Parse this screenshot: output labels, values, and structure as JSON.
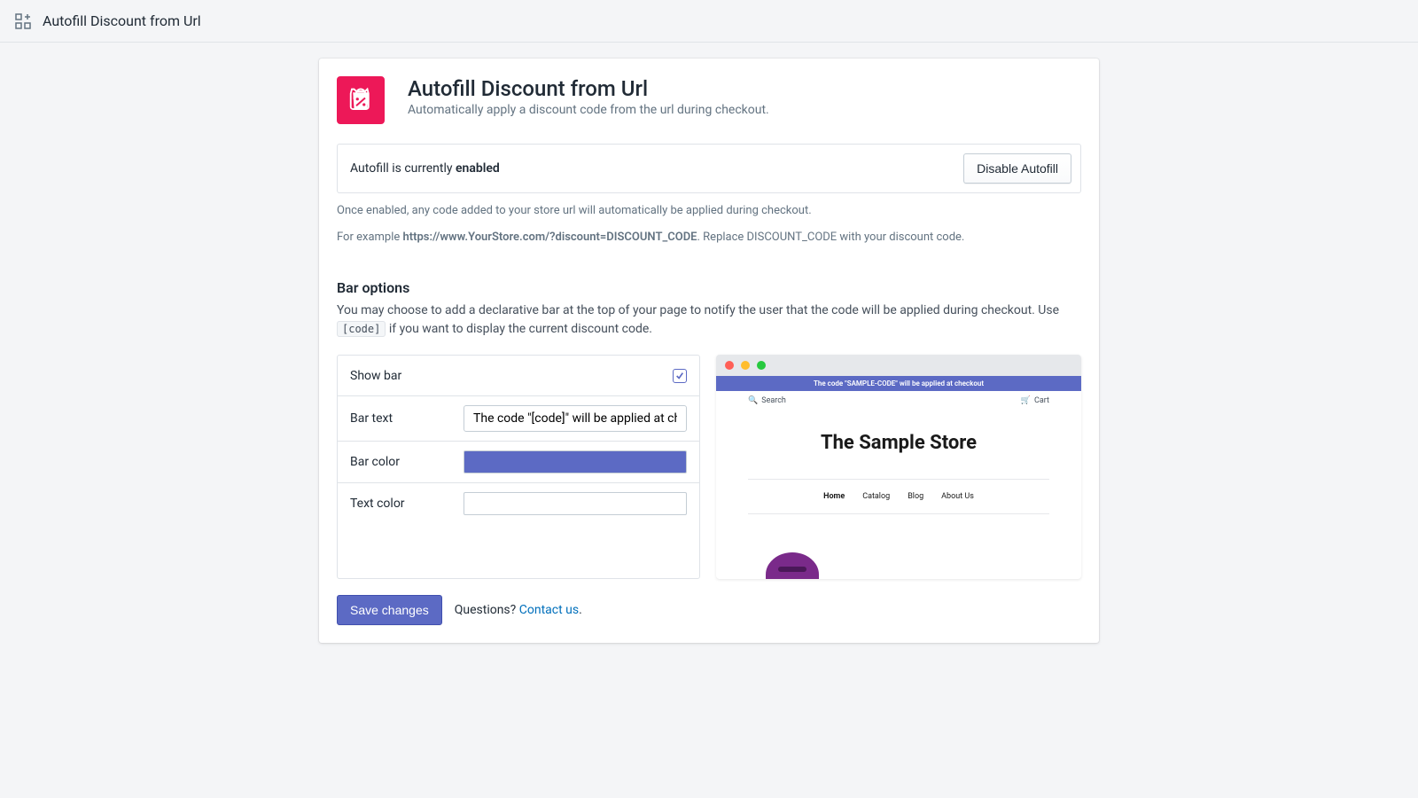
{
  "topbar": {
    "title": "Autofill Discount from Url"
  },
  "app": {
    "title": "Autofill Discount from Url",
    "subtitle": "Automatically apply a discount code from the url during checkout."
  },
  "status": {
    "prefix": "Autofill is currently ",
    "state": "enabled",
    "disable_btn": "Disable Autofill",
    "help1": "Once enabled, any code added to your store url will automatically be applied during checkout.",
    "help2_prefix": "For example ",
    "help2_url": "https://www.YourStore.com/?discount=DISCOUNT_CODE",
    "help2_suffix": ". Replace DISCOUNT_CODE with your discount code."
  },
  "bar": {
    "title": "Bar options",
    "desc_prefix": "You may choose to add a declarative bar at the top of your page to notify the user that the code will be applied during checkout. Use ",
    "desc_code": "[code]",
    "desc_suffix": " if you want to display the current discount code.",
    "rows": {
      "show": "Show bar",
      "text_label": "Bar text",
      "text_value": "The code \"[code]\" will be applied at checkout",
      "color_label": "Bar color",
      "color_value": "#5c6ac4",
      "textcolor_label": "Text color",
      "textcolor_value": "#ffffff"
    }
  },
  "preview": {
    "bar_text": "The code \"SAMPLE-CODE\" will be applied at checkout",
    "search": "Search",
    "cart": "Cart",
    "store_name": "The Sample Store",
    "tabs": [
      "Home",
      "Catalog",
      "Blog",
      "About Us"
    ]
  },
  "footer": {
    "save": "Save changes",
    "questions": "Questions? ",
    "contact": "Contact us",
    "period": "."
  }
}
